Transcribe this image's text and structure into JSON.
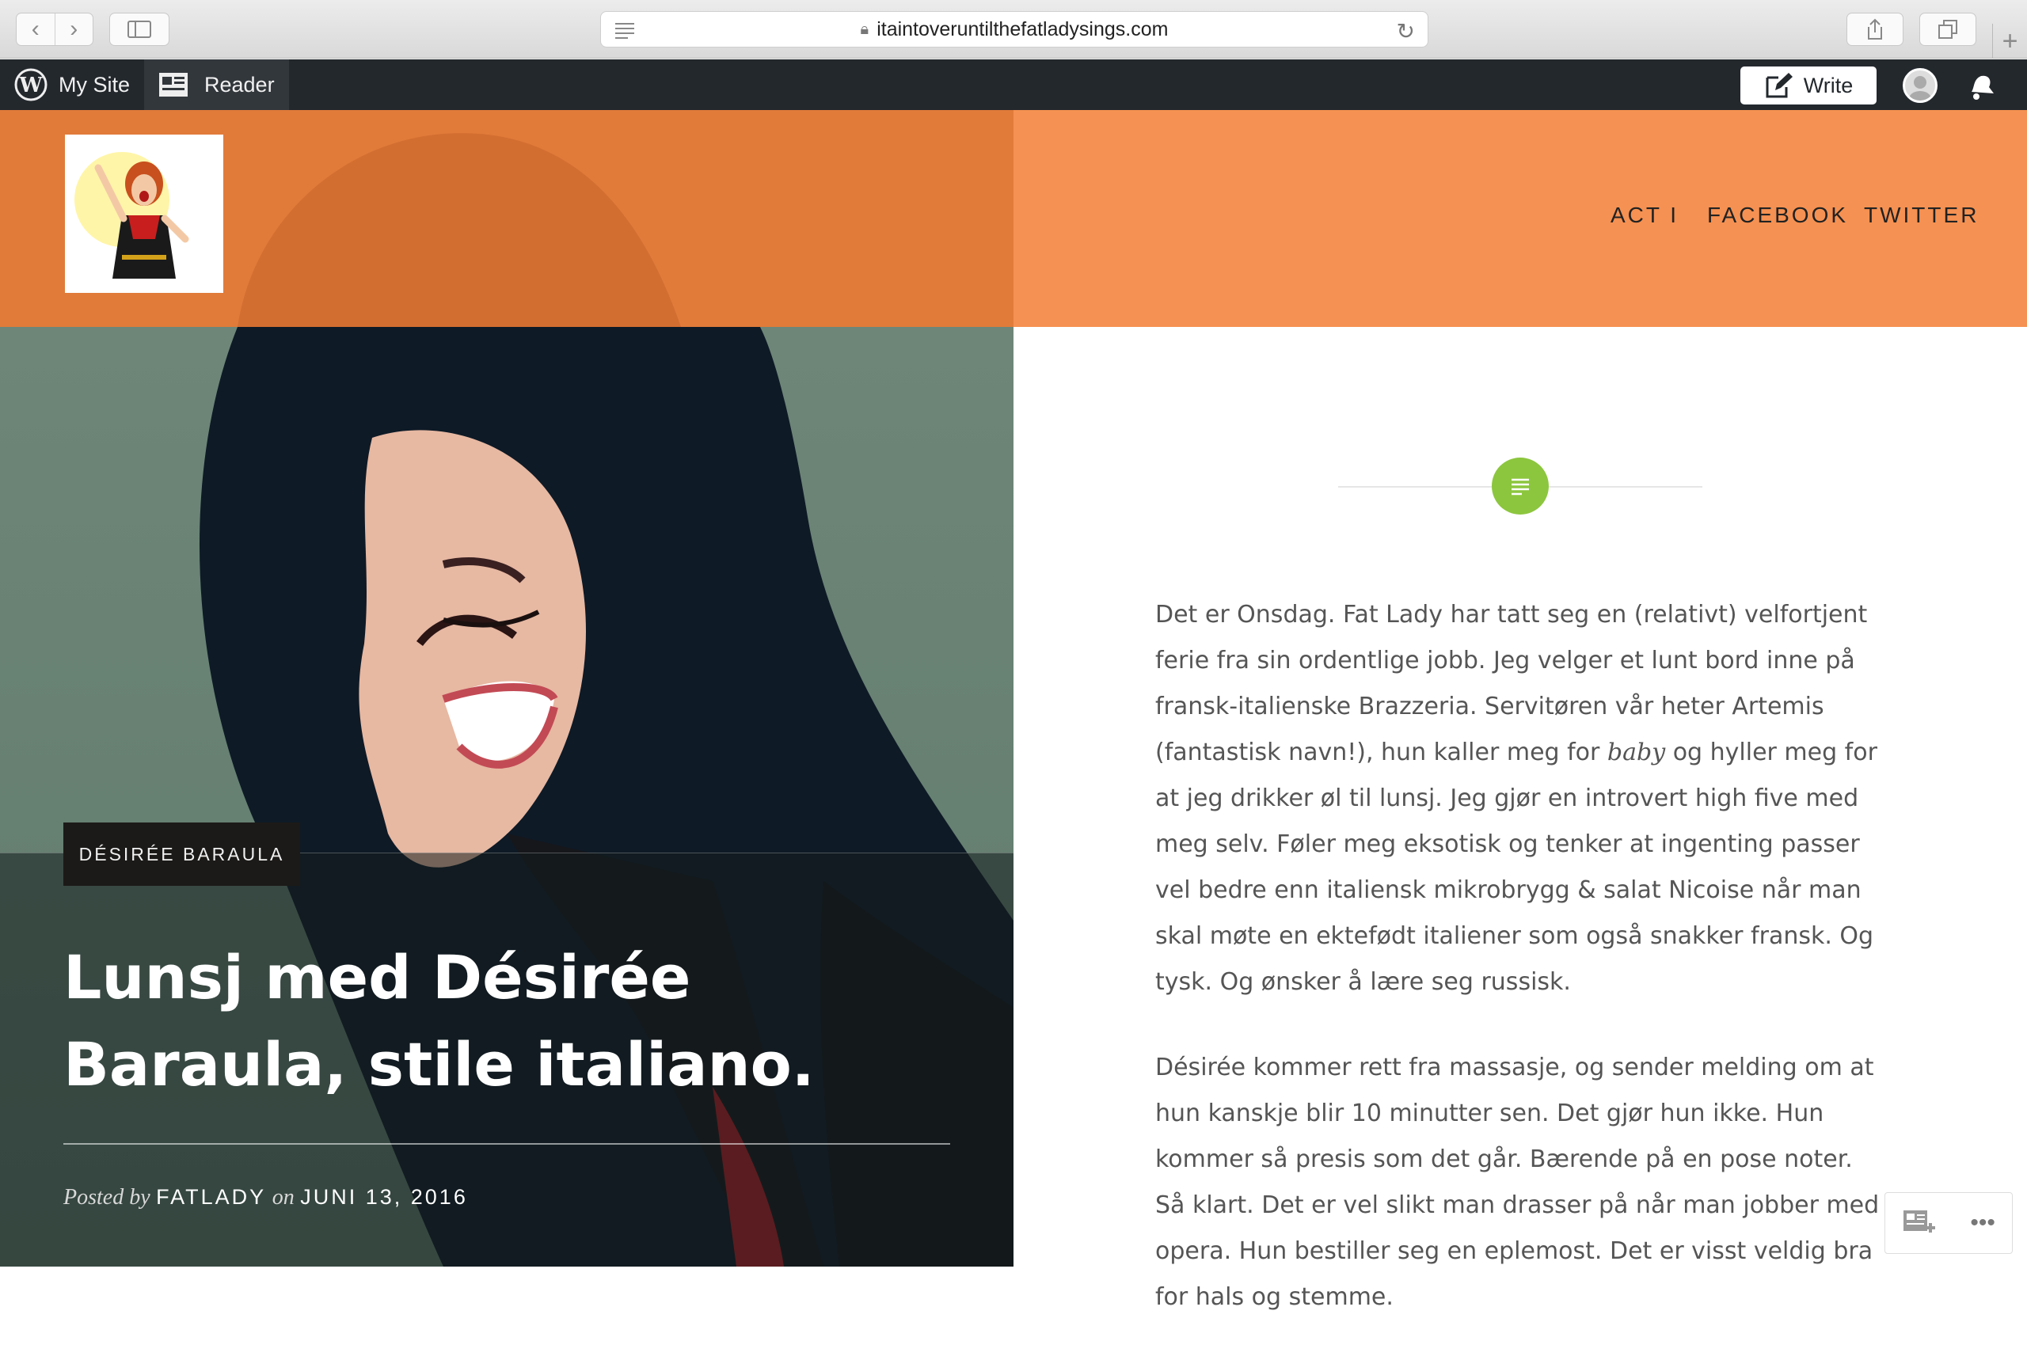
{
  "browser": {
    "url": "itaintoveruntilthefatladysings.com"
  },
  "admin_bar": {
    "my_site": "My Site",
    "reader": "Reader",
    "write": "Write"
  },
  "site": {
    "menu": [
      "ACT I",
      "FACEBOOK",
      "TWITTER"
    ]
  },
  "post": {
    "category": "DÉSIRÉE BARAULA",
    "title": "Lunsj med Désirée Baraula, stile italiano.",
    "posted_by_label": "Posted by",
    "author": "FATLADY",
    "on_label": "on",
    "date": "JUNI 13, 2016",
    "paragraph_1_a": "Det er Onsdag. Fat Lady har tatt seg en (relativt) velfortjent ferie fra sin ordentlige jobb. Jeg velger et lunt bord inne på fransk-italienske Brazzeria. Servitøren vår heter Artemis (fantastisk navn!), hun kaller meg for ",
    "paragraph_1_em": "baby",
    "paragraph_1_b": " og hyller meg for at jeg drikker øl til lunsj. Jeg gjør en introvert high five med meg selv. Føler meg eksotisk og tenker at ingenting passer vel bedre enn italiensk mikrobrygg & salat Nicoise når man skal møte en ektefødt italiener som også snakker fransk. Og tysk. Og ønsker å lære seg russisk.",
    "paragraph_2": "Désirée kommer rett fra massasje, og sender melding om at hun kanskje blir 10 minutter sen. Det gjør hun ikke. Hun kommer så presis som det går. Bærende på en pose noter. Så klart. Det er vel slikt man drasser på når man jobber med opera. Hun bestiller seg en eplemost. Det er visst veldig bra for hals og stemme."
  },
  "colors": {
    "admin_bar": "#23282d",
    "header_left": "#e07b3a",
    "header_right": "#f59152",
    "format_icon": "#8cc63e",
    "badge": "#1c1a18"
  },
  "icons": [
    "back-icon",
    "forward-icon",
    "sidebar-icon",
    "reader-view-icon",
    "lock-icon",
    "reload-icon",
    "share-icon",
    "tabs-icon",
    "new-tab-icon",
    "wordpress-logo-icon",
    "reader-icon",
    "write-icon",
    "avatar-icon",
    "notifications-icon",
    "standard-format-icon",
    "follow-icon",
    "more-icon"
  ]
}
